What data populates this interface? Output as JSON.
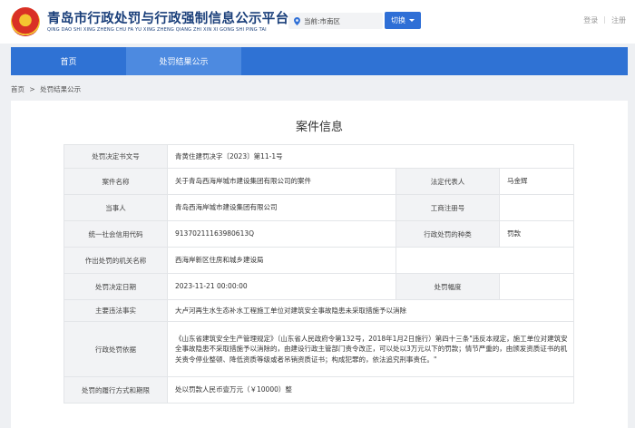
{
  "header": {
    "title": "青岛市行政处罚与行政强制信息公示平台",
    "subtitle": "QING DAO SHI XING ZHENG CHU FA YU XING ZHENG QIANG ZHI XIN XI GONG SHI PING TAI",
    "location_label": "当前:市南区",
    "switch_label": "切换",
    "login": "登录",
    "register": "注册",
    "separator": "|"
  },
  "nav": {
    "items": [
      "首页",
      "处罚结果公示"
    ]
  },
  "breadcrumb": {
    "home": "首页",
    "separator": ">",
    "current": "处罚结果公示"
  },
  "case": {
    "title": "案件信息",
    "rows": {
      "decision_no_label": "处罚决定书文号",
      "decision_no": "青黄住建罚决字〔2023〕第11-1号",
      "case_name_label": "案件名称",
      "case_name": "关于青岛西海岸城市建设集团有限公司的案件",
      "legal_rep_label": "法定代表人",
      "legal_rep": "马金辉",
      "party_label": "当事人",
      "party": "青岛西海岸城市建设集团有限公司",
      "reg_no_label": "工商注册号",
      "reg_no": "",
      "credit_code_label": "统一社会信用代码",
      "credit_code": "91370211163980613Q",
      "penalty_type_label": "行政处罚的种类",
      "penalty_type": "罚款",
      "authority_label": "作出处罚的机关名称",
      "authority": "西海岸新区住房和城乡建设局",
      "date_label": "处罚决定日期",
      "date": "2023-11-21 00:00:00",
      "range_label": "处罚幅度",
      "range": "",
      "facts_label": "主要违法事实",
      "facts": "大卢河再生水生态补水工程施工单位对建筑安全事故隐患未采取措施予以消除",
      "basis_label": "行政处罚依据",
      "basis": "《山东省建筑安全生产管理规定》（山东省人民政府令第132号，2018年1月2日施行）第四十三条\"违反本规定，施工单位对建筑安全事故隐患不采取措施予以消除的，由建设行政主管部门责令改正，可以处以3万元以下的罚款；情节严重的，由颁发资质证书的机关责令停业整顿、降低资质等级或者吊销资质证书；构成犯罪的，依法追究刑事责任。\"",
      "performance_label": "处罚的履行方式和期限",
      "performance": "处以罚款人民币壹万元（￥10000）整"
    }
  },
  "colors": {
    "brand": "#1a3f7a",
    "nav": "#2f72d4",
    "nav_active": "#4d8ae0",
    "switch": "#2f6fd6"
  }
}
